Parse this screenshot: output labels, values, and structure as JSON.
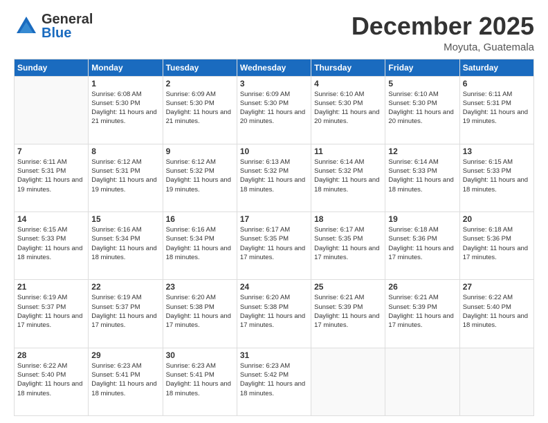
{
  "header": {
    "logo_general": "General",
    "logo_blue": "Blue",
    "month": "December 2025",
    "location": "Moyuta, Guatemala"
  },
  "weekdays": [
    "Sunday",
    "Monday",
    "Tuesday",
    "Wednesday",
    "Thursday",
    "Friday",
    "Saturday"
  ],
  "weeks": [
    [
      {
        "day": "",
        "empty": true
      },
      {
        "day": "1",
        "sunrise": "Sunrise: 6:08 AM",
        "sunset": "Sunset: 5:30 PM",
        "daylight": "Daylight: 11 hours and 21 minutes."
      },
      {
        "day": "2",
        "sunrise": "Sunrise: 6:09 AM",
        "sunset": "Sunset: 5:30 PM",
        "daylight": "Daylight: 11 hours and 21 minutes."
      },
      {
        "day": "3",
        "sunrise": "Sunrise: 6:09 AM",
        "sunset": "Sunset: 5:30 PM",
        "daylight": "Daylight: 11 hours and 20 minutes."
      },
      {
        "day": "4",
        "sunrise": "Sunrise: 6:10 AM",
        "sunset": "Sunset: 5:30 PM",
        "daylight": "Daylight: 11 hours and 20 minutes."
      },
      {
        "day": "5",
        "sunrise": "Sunrise: 6:10 AM",
        "sunset": "Sunset: 5:30 PM",
        "daylight": "Daylight: 11 hours and 20 minutes."
      },
      {
        "day": "6",
        "sunrise": "Sunrise: 6:11 AM",
        "sunset": "Sunset: 5:31 PM",
        "daylight": "Daylight: 11 hours and 19 minutes."
      }
    ],
    [
      {
        "day": "7",
        "sunrise": "Sunrise: 6:11 AM",
        "sunset": "Sunset: 5:31 PM",
        "daylight": "Daylight: 11 hours and 19 minutes."
      },
      {
        "day": "8",
        "sunrise": "Sunrise: 6:12 AM",
        "sunset": "Sunset: 5:31 PM",
        "daylight": "Daylight: 11 hours and 19 minutes."
      },
      {
        "day": "9",
        "sunrise": "Sunrise: 6:12 AM",
        "sunset": "Sunset: 5:32 PM",
        "daylight": "Daylight: 11 hours and 19 minutes."
      },
      {
        "day": "10",
        "sunrise": "Sunrise: 6:13 AM",
        "sunset": "Sunset: 5:32 PM",
        "daylight": "Daylight: 11 hours and 18 minutes."
      },
      {
        "day": "11",
        "sunrise": "Sunrise: 6:14 AM",
        "sunset": "Sunset: 5:32 PM",
        "daylight": "Daylight: 11 hours and 18 minutes."
      },
      {
        "day": "12",
        "sunrise": "Sunrise: 6:14 AM",
        "sunset": "Sunset: 5:33 PM",
        "daylight": "Daylight: 11 hours and 18 minutes."
      },
      {
        "day": "13",
        "sunrise": "Sunrise: 6:15 AM",
        "sunset": "Sunset: 5:33 PM",
        "daylight": "Daylight: 11 hours and 18 minutes."
      }
    ],
    [
      {
        "day": "14",
        "sunrise": "Sunrise: 6:15 AM",
        "sunset": "Sunset: 5:33 PM",
        "daylight": "Daylight: 11 hours and 18 minutes."
      },
      {
        "day": "15",
        "sunrise": "Sunrise: 6:16 AM",
        "sunset": "Sunset: 5:34 PM",
        "daylight": "Daylight: 11 hours and 18 minutes."
      },
      {
        "day": "16",
        "sunrise": "Sunrise: 6:16 AM",
        "sunset": "Sunset: 5:34 PM",
        "daylight": "Daylight: 11 hours and 18 minutes."
      },
      {
        "day": "17",
        "sunrise": "Sunrise: 6:17 AM",
        "sunset": "Sunset: 5:35 PM",
        "daylight": "Daylight: 11 hours and 17 minutes."
      },
      {
        "day": "18",
        "sunrise": "Sunrise: 6:17 AM",
        "sunset": "Sunset: 5:35 PM",
        "daylight": "Daylight: 11 hours and 17 minutes."
      },
      {
        "day": "19",
        "sunrise": "Sunrise: 6:18 AM",
        "sunset": "Sunset: 5:36 PM",
        "daylight": "Daylight: 11 hours and 17 minutes."
      },
      {
        "day": "20",
        "sunrise": "Sunrise: 6:18 AM",
        "sunset": "Sunset: 5:36 PM",
        "daylight": "Daylight: 11 hours and 17 minutes."
      }
    ],
    [
      {
        "day": "21",
        "sunrise": "Sunrise: 6:19 AM",
        "sunset": "Sunset: 5:37 PM",
        "daylight": "Daylight: 11 hours and 17 minutes."
      },
      {
        "day": "22",
        "sunrise": "Sunrise: 6:19 AM",
        "sunset": "Sunset: 5:37 PM",
        "daylight": "Daylight: 11 hours and 17 minutes."
      },
      {
        "day": "23",
        "sunrise": "Sunrise: 6:20 AM",
        "sunset": "Sunset: 5:38 PM",
        "daylight": "Daylight: 11 hours and 17 minutes."
      },
      {
        "day": "24",
        "sunrise": "Sunrise: 6:20 AM",
        "sunset": "Sunset: 5:38 PM",
        "daylight": "Daylight: 11 hours and 17 minutes."
      },
      {
        "day": "25",
        "sunrise": "Sunrise: 6:21 AM",
        "sunset": "Sunset: 5:39 PM",
        "daylight": "Daylight: 11 hours and 17 minutes."
      },
      {
        "day": "26",
        "sunrise": "Sunrise: 6:21 AM",
        "sunset": "Sunset: 5:39 PM",
        "daylight": "Daylight: 11 hours and 17 minutes."
      },
      {
        "day": "27",
        "sunrise": "Sunrise: 6:22 AM",
        "sunset": "Sunset: 5:40 PM",
        "daylight": "Daylight: 11 hours and 18 minutes."
      }
    ],
    [
      {
        "day": "28",
        "sunrise": "Sunrise: 6:22 AM",
        "sunset": "Sunset: 5:40 PM",
        "daylight": "Daylight: 11 hours and 18 minutes."
      },
      {
        "day": "29",
        "sunrise": "Sunrise: 6:23 AM",
        "sunset": "Sunset: 5:41 PM",
        "daylight": "Daylight: 11 hours and 18 minutes."
      },
      {
        "day": "30",
        "sunrise": "Sunrise: 6:23 AM",
        "sunset": "Sunset: 5:41 PM",
        "daylight": "Daylight: 11 hours and 18 minutes."
      },
      {
        "day": "31",
        "sunrise": "Sunrise: 6:23 AM",
        "sunset": "Sunset: 5:42 PM",
        "daylight": "Daylight: 11 hours and 18 minutes."
      },
      {
        "day": "",
        "empty": true
      },
      {
        "day": "",
        "empty": true
      },
      {
        "day": "",
        "empty": true
      }
    ]
  ]
}
